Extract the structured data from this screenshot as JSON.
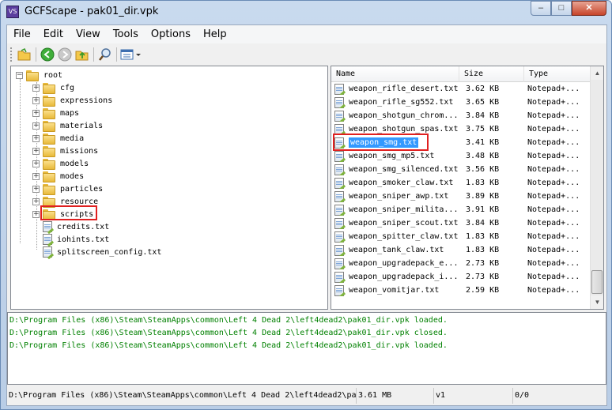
{
  "window": {
    "title": "GCFScape - pak01_dir.vpk",
    "app_icon_text": "VS"
  },
  "menu": [
    "File",
    "Edit",
    "View",
    "Tools",
    "Options",
    "Help"
  ],
  "toolbar": {
    "buttons": [
      "open-folder-icon",
      "back-icon",
      "forward-icon",
      "up-folder-icon",
      "find-icon",
      "view-mode-icon"
    ]
  },
  "tree": {
    "root": "root",
    "folders": [
      "cfg",
      "expressions",
      "maps",
      "materials",
      "media",
      "missions",
      "models",
      "modes",
      "particles",
      "resource",
      "scripts"
    ],
    "files": [
      "credits.txt",
      "iohints.txt",
      "splitscreen_config.txt"
    ]
  },
  "list": {
    "columns": [
      "Name",
      "Size",
      "Type"
    ],
    "rows": [
      {
        "name": "weapon_rifle_desert.txt",
        "size": "3.62 KB",
        "type": "Notepad+..."
      },
      {
        "name": "weapon_rifle_sg552.txt",
        "size": "3.65 KB",
        "type": "Notepad+..."
      },
      {
        "name": "weapon_shotgun_chrom...",
        "size": "3.84 KB",
        "type": "Notepad+..."
      },
      {
        "name": "weapon_shotgun_spas.txt",
        "size": "3.75 KB",
        "type": "Notepad+..."
      },
      {
        "name": "weapon_smg.txt",
        "size": "3.41 KB",
        "type": "Notepad+..."
      },
      {
        "name": "weapon_smg_mp5.txt",
        "size": "3.48 KB",
        "type": "Notepad+..."
      },
      {
        "name": "weapon_smg_silenced.txt",
        "size": "3.56 KB",
        "type": "Notepad+..."
      },
      {
        "name": "weapon_smoker_claw.txt",
        "size": "1.83 KB",
        "type": "Notepad+..."
      },
      {
        "name": "weapon_sniper_awp.txt",
        "size": "3.89 KB",
        "type": "Notepad+..."
      },
      {
        "name": "weapon_sniper_milita...",
        "size": "3.91 KB",
        "type": "Notepad+..."
      },
      {
        "name": "weapon_sniper_scout.txt",
        "size": "3.84 KB",
        "type": "Notepad+..."
      },
      {
        "name": "weapon_spitter_claw.txt",
        "size": "1.83 KB",
        "type": "Notepad+..."
      },
      {
        "name": "weapon_tank_claw.txt",
        "size": "1.83 KB",
        "type": "Notepad+..."
      },
      {
        "name": "weapon_upgradepack_e...",
        "size": "2.73 KB",
        "type": "Notepad+..."
      },
      {
        "name": "weapon_upgradepack_i...",
        "size": "2.73 KB",
        "type": "Notepad+..."
      },
      {
        "name": "weapon_vomitjar.txt",
        "size": "2.59 KB",
        "type": "Notepad+..."
      }
    ],
    "selected": "weapon_smg.txt"
  },
  "log": [
    "D:\\Program Files (x86)\\Steam\\SteamApps\\common\\Left 4 Dead 2\\left4dead2\\pak01_dir.vpk loaded.",
    "D:\\Program Files (x86)\\Steam\\SteamApps\\common\\Left 4 Dead 2\\left4dead2\\pak01_dir.vpk closed.",
    "D:\\Program Files (x86)\\Steam\\SteamApps\\common\\Left 4 Dead 2\\left4dead2\\pak01_dir.vpk loaded."
  ],
  "status": {
    "path": "D:\\Program Files (x86)\\Steam\\SteamApps\\common\\Left 4 Dead 2\\left4dead2\\pa",
    "size": "3.61 MB",
    "version": "v1",
    "count": "0/0"
  },
  "colors": {
    "selection": "#3399ff",
    "log_text": "#008000",
    "highlight_box": "#e02020"
  }
}
